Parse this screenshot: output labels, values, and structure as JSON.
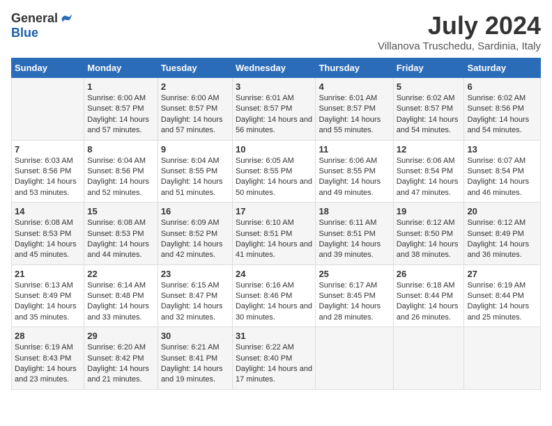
{
  "logo": {
    "general": "General",
    "blue": "Blue"
  },
  "title": "July 2024",
  "subtitle": "Villanova Truschedu, Sardinia, Italy",
  "days_of_week": [
    "Sunday",
    "Monday",
    "Tuesday",
    "Wednesday",
    "Thursday",
    "Friday",
    "Saturday"
  ],
  "weeks": [
    [
      {
        "day": "",
        "sunrise": "",
        "sunset": "",
        "daylight": ""
      },
      {
        "day": "1",
        "sunrise": "Sunrise: 6:00 AM",
        "sunset": "Sunset: 8:57 PM",
        "daylight": "Daylight: 14 hours and 57 minutes."
      },
      {
        "day": "2",
        "sunrise": "Sunrise: 6:00 AM",
        "sunset": "Sunset: 8:57 PM",
        "daylight": "Daylight: 14 hours and 57 minutes."
      },
      {
        "day": "3",
        "sunrise": "Sunrise: 6:01 AM",
        "sunset": "Sunset: 8:57 PM",
        "daylight": "Daylight: 14 hours and 56 minutes."
      },
      {
        "day": "4",
        "sunrise": "Sunrise: 6:01 AM",
        "sunset": "Sunset: 8:57 PM",
        "daylight": "Daylight: 14 hours and 55 minutes."
      },
      {
        "day": "5",
        "sunrise": "Sunrise: 6:02 AM",
        "sunset": "Sunset: 8:57 PM",
        "daylight": "Daylight: 14 hours and 54 minutes."
      },
      {
        "day": "6",
        "sunrise": "Sunrise: 6:02 AM",
        "sunset": "Sunset: 8:56 PM",
        "daylight": "Daylight: 14 hours and 54 minutes."
      }
    ],
    [
      {
        "day": "7",
        "sunrise": "Sunrise: 6:03 AM",
        "sunset": "Sunset: 8:56 PM",
        "daylight": "Daylight: 14 hours and 53 minutes."
      },
      {
        "day": "8",
        "sunrise": "Sunrise: 6:04 AM",
        "sunset": "Sunset: 8:56 PM",
        "daylight": "Daylight: 14 hours and 52 minutes."
      },
      {
        "day": "9",
        "sunrise": "Sunrise: 6:04 AM",
        "sunset": "Sunset: 8:55 PM",
        "daylight": "Daylight: 14 hours and 51 minutes."
      },
      {
        "day": "10",
        "sunrise": "Sunrise: 6:05 AM",
        "sunset": "Sunset: 8:55 PM",
        "daylight": "Daylight: 14 hours and 50 minutes."
      },
      {
        "day": "11",
        "sunrise": "Sunrise: 6:06 AM",
        "sunset": "Sunset: 8:55 PM",
        "daylight": "Daylight: 14 hours and 49 minutes."
      },
      {
        "day": "12",
        "sunrise": "Sunrise: 6:06 AM",
        "sunset": "Sunset: 8:54 PM",
        "daylight": "Daylight: 14 hours and 47 minutes."
      },
      {
        "day": "13",
        "sunrise": "Sunrise: 6:07 AM",
        "sunset": "Sunset: 8:54 PM",
        "daylight": "Daylight: 14 hours and 46 minutes."
      }
    ],
    [
      {
        "day": "14",
        "sunrise": "Sunrise: 6:08 AM",
        "sunset": "Sunset: 8:53 PM",
        "daylight": "Daylight: 14 hours and 45 minutes."
      },
      {
        "day": "15",
        "sunrise": "Sunrise: 6:08 AM",
        "sunset": "Sunset: 8:53 PM",
        "daylight": "Daylight: 14 hours and 44 minutes."
      },
      {
        "day": "16",
        "sunrise": "Sunrise: 6:09 AM",
        "sunset": "Sunset: 8:52 PM",
        "daylight": "Daylight: 14 hours and 42 minutes."
      },
      {
        "day": "17",
        "sunrise": "Sunrise: 6:10 AM",
        "sunset": "Sunset: 8:51 PM",
        "daylight": "Daylight: 14 hours and 41 minutes."
      },
      {
        "day": "18",
        "sunrise": "Sunrise: 6:11 AM",
        "sunset": "Sunset: 8:51 PM",
        "daylight": "Daylight: 14 hours and 39 minutes."
      },
      {
        "day": "19",
        "sunrise": "Sunrise: 6:12 AM",
        "sunset": "Sunset: 8:50 PM",
        "daylight": "Daylight: 14 hours and 38 minutes."
      },
      {
        "day": "20",
        "sunrise": "Sunrise: 6:12 AM",
        "sunset": "Sunset: 8:49 PM",
        "daylight": "Daylight: 14 hours and 36 minutes."
      }
    ],
    [
      {
        "day": "21",
        "sunrise": "Sunrise: 6:13 AM",
        "sunset": "Sunset: 8:49 PM",
        "daylight": "Daylight: 14 hours and 35 minutes."
      },
      {
        "day": "22",
        "sunrise": "Sunrise: 6:14 AM",
        "sunset": "Sunset: 8:48 PM",
        "daylight": "Daylight: 14 hours and 33 minutes."
      },
      {
        "day": "23",
        "sunrise": "Sunrise: 6:15 AM",
        "sunset": "Sunset: 8:47 PM",
        "daylight": "Daylight: 14 hours and 32 minutes."
      },
      {
        "day": "24",
        "sunrise": "Sunrise: 6:16 AM",
        "sunset": "Sunset: 8:46 PM",
        "daylight": "Daylight: 14 hours and 30 minutes."
      },
      {
        "day": "25",
        "sunrise": "Sunrise: 6:17 AM",
        "sunset": "Sunset: 8:45 PM",
        "daylight": "Daylight: 14 hours and 28 minutes."
      },
      {
        "day": "26",
        "sunrise": "Sunrise: 6:18 AM",
        "sunset": "Sunset: 8:44 PM",
        "daylight": "Daylight: 14 hours and 26 minutes."
      },
      {
        "day": "27",
        "sunrise": "Sunrise: 6:19 AM",
        "sunset": "Sunset: 8:44 PM",
        "daylight": "Daylight: 14 hours and 25 minutes."
      }
    ],
    [
      {
        "day": "28",
        "sunrise": "Sunrise: 6:19 AM",
        "sunset": "Sunset: 8:43 PM",
        "daylight": "Daylight: 14 hours and 23 minutes."
      },
      {
        "day": "29",
        "sunrise": "Sunrise: 6:20 AM",
        "sunset": "Sunset: 8:42 PM",
        "daylight": "Daylight: 14 hours and 21 minutes."
      },
      {
        "day": "30",
        "sunrise": "Sunrise: 6:21 AM",
        "sunset": "Sunset: 8:41 PM",
        "daylight": "Daylight: 14 hours and 19 minutes."
      },
      {
        "day": "31",
        "sunrise": "Sunrise: 6:22 AM",
        "sunset": "Sunset: 8:40 PM",
        "daylight": "Daylight: 14 hours and 17 minutes."
      },
      {
        "day": "",
        "sunrise": "",
        "sunset": "",
        "daylight": ""
      },
      {
        "day": "",
        "sunrise": "",
        "sunset": "",
        "daylight": ""
      },
      {
        "day": "",
        "sunrise": "",
        "sunset": "",
        "daylight": ""
      }
    ]
  ]
}
